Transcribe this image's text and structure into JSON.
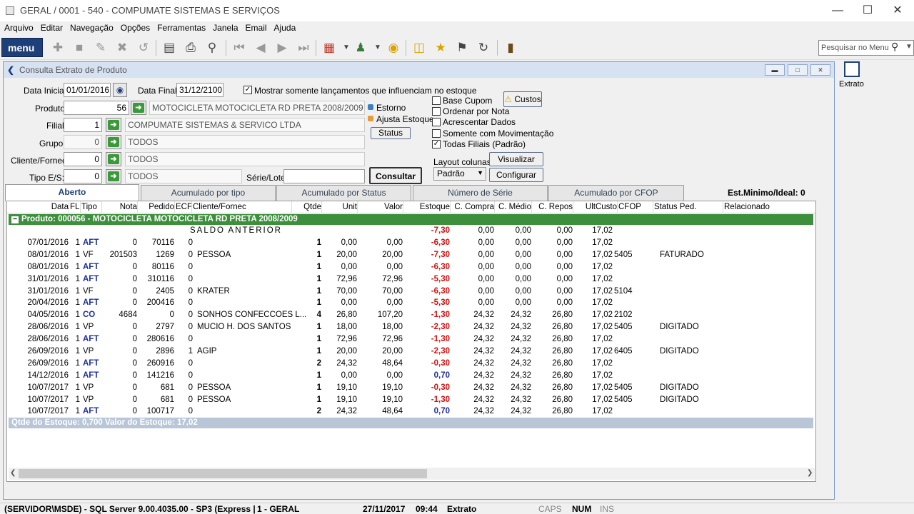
{
  "app": {
    "title": "GERAL / 0001 - 540 - COMPUMATE SISTEMAS E SERVIÇOS"
  },
  "menu": [
    "Arquivo",
    "Editar",
    "Navegação",
    "Opções",
    "Ferramentas",
    "Janela",
    "Email",
    "Ajuda"
  ],
  "toolbar": {
    "menu_label": "menu",
    "search_placeholder": "Pesquisar no Menu"
  },
  "side": {
    "extrato_label": "Extrato"
  },
  "window": {
    "title": "Consulta Extrato de Produto"
  },
  "form": {
    "data_inicial_label": "Data Inicial:",
    "data_inicial": "01/01/2016",
    "data_final_label": "Data Final:",
    "data_final": "31/12/2100",
    "mostrar_label": "Mostrar somente lançamentos que influenciam no estoque",
    "produto_label": "Produto:",
    "produto_code": "56",
    "produto_desc": "MOTOCICLETA  MOTOCICLETA RD PRETA 2008/2009",
    "filial_label": "Filial:",
    "filial_code": "1",
    "filial_desc": "COMPUMATE SISTEMAS & SERVICO LTDA",
    "grupo_label": "Grupo:",
    "grupo_code": "0",
    "grupo_desc": "TODOS",
    "cliente_label": "Cliente/Fornec:",
    "cliente_code": "0",
    "cliente_desc": "TODOS",
    "tipo_label": "Tipo E/S:",
    "tipo_code": "0",
    "tipo_desc": "TODOS",
    "serie_label": "Série/Lote:",
    "serie_value": "",
    "estorno_label": "Estorno",
    "ajusta_label": "Ajusta Estoque",
    "status_btn": "Status",
    "consultar_btn": "Consultar",
    "base_cupom": "Base Cupom",
    "ordenar_nota": "Ordenar por Nota",
    "acrescentar": "Acrescentar Dados",
    "somente_mov": "Somente com Movimentação",
    "todas_filiais": "Todas Filiais (Padrão)",
    "custos_btn": "Custos",
    "layout_label": "Layout colunas",
    "layout_value": "Padrão",
    "visualizar_btn": "Visualizar",
    "configurar_btn": "Configurar"
  },
  "tabs": [
    "Aberto",
    "Acumulado por tipo",
    "Acumulado por Status",
    "Número de Série",
    "Acumulado por CFOP"
  ],
  "est_minimo": "Est.Minimo/Ideal:  0",
  "grid": {
    "headers": [
      "Data",
      "FL",
      "Tipo",
      "Nota",
      "Pedido",
      "ECF",
      "Cliente/Fornec",
      "Qtde",
      "Unit",
      "Valor",
      "Estoque",
      "C. Compra",
      "C. Médio",
      "C. Repos",
      "UltCusto",
      "CFOP",
      "Status Ped.",
      "Relacionado"
    ],
    "group": "Produto:  000056 - MOTOCICLETA  MOTOCICLETA RD PRETA 2008/2009",
    "saldo": {
      "label": "SALDO ANTERIOR",
      "estoque": "-7,30",
      "c_compra": "0,00",
      "c_medio": "0,00",
      "c_repos": "0,00",
      "ult": "17,02"
    },
    "rows": [
      [
        "07/01/2016",
        "1",
        "AFT",
        "0",
        "70116",
        "0",
        "",
        "1",
        "0,00",
        "0,00",
        "-6,30",
        "0,00",
        "0,00",
        "0,00",
        "17,02",
        "",
        ""
      ],
      [
        "08/01/2016",
        "1",
        "VF",
        "201503",
        "1269",
        "0",
        "PESSOA",
        "1",
        "20,00",
        "20,00",
        "-7,30",
        "0,00",
        "0,00",
        "0,00",
        "17,02",
        "5405",
        "FATURADO"
      ],
      [
        "08/01/2016",
        "1",
        "AFT",
        "0",
        "80116",
        "0",
        "",
        "1",
        "0,00",
        "0,00",
        "-6,30",
        "0,00",
        "0,00",
        "0,00",
        "17,02",
        "",
        ""
      ],
      [
        "31/01/2016",
        "1",
        "AFT",
        "0",
        "310116",
        "0",
        "",
        "1",
        "72,96",
        "72,96",
        "-5,30",
        "0,00",
        "0,00",
        "0,00",
        "17,02",
        "",
        ""
      ],
      [
        "31/01/2016",
        "1",
        "VF",
        "0",
        "2405",
        "0",
        "KRATER",
        "1",
        "70,00",
        "70,00",
        "-6,30",
        "0,00",
        "0,00",
        "0,00",
        "17,02",
        "5104",
        ""
      ],
      [
        "20/04/2016",
        "1",
        "AFT",
        "0",
        "200416",
        "0",
        "",
        "1",
        "0,00",
        "0,00",
        "-5,30",
        "0,00",
        "0,00",
        "0,00",
        "17,02",
        "",
        ""
      ],
      [
        "04/05/2016",
        "1",
        "CO",
        "4684",
        "0",
        "0",
        "SONHOS CONFECCOES L...",
        "4",
        "26,80",
        "107,20",
        "-1,30",
        "24,32",
        "24,32",
        "26,80",
        "17,02",
        "2102",
        ""
      ],
      [
        "28/06/2016",
        "1",
        "VP",
        "0",
        "2797",
        "0",
        "MUCIO H. DOS SANTOS",
        "1",
        "18,00",
        "18,00",
        "-2,30",
        "24,32",
        "24,32",
        "26,80",
        "17,02",
        "5405",
        "DIGITADO"
      ],
      [
        "28/06/2016",
        "1",
        "AFT",
        "0",
        "280616",
        "0",
        "",
        "1",
        "72,96",
        "72,96",
        "-1,30",
        "24,32",
        "24,32",
        "26,80",
        "17,02",
        "",
        ""
      ],
      [
        "26/09/2016",
        "1",
        "VP",
        "0",
        "2896",
        "1",
        "AGIP",
        "1",
        "20,00",
        "20,00",
        "-2,30",
        "24,32",
        "24,32",
        "26,80",
        "17,02",
        "6405",
        "DIGITADO"
      ],
      [
        "26/09/2016",
        "1",
        "AFT",
        "0",
        "260916",
        "0",
        "",
        "2",
        "24,32",
        "48,64",
        "-0,30",
        "24,32",
        "24,32",
        "26,80",
        "17,02",
        "",
        ""
      ],
      [
        "14/12/2016",
        "1",
        "AFT",
        "0",
        "141216",
        "0",
        "",
        "1",
        "0,00",
        "0,00",
        "0,70",
        "24,32",
        "24,32",
        "26,80",
        "17,02",
        "",
        ""
      ],
      [
        "10/07/2017",
        "1",
        "VP",
        "0",
        "681",
        "0",
        "PESSOA",
        "1",
        "19,10",
        "19,10",
        "-0,30",
        "24,32",
        "24,32",
        "26,80",
        "17,02",
        "5405",
        "DIGITADO"
      ],
      [
        "10/07/2017",
        "1",
        "VP",
        "0",
        "681",
        "0",
        "PESSOA",
        "1",
        "19,10",
        "19,10",
        "-1,30",
        "24,32",
        "24,32",
        "26,80",
        "17,02",
        "5405",
        "DIGITADO"
      ],
      [
        "10/07/2017",
        "1",
        "AFT",
        "0",
        "100717",
        "0",
        "",
        "2",
        "24,32",
        "48,64",
        "0,70",
        "24,32",
        "24,32",
        "26,80",
        "17,02",
        "",
        ""
      ]
    ],
    "footer": "Qtde do Estoque: 0,700    Valor do Estoque: 17,02"
  },
  "status": {
    "server": "(SERVIDOR\\MSDE) - SQL Server 9.00.4035.00 - SP3 (Express |",
    "empresa": "1 - GERAL",
    "date": "27/11/2017",
    "time": "09:44",
    "screen": "Extrato",
    "caps": "CAPS",
    "num": "NUM",
    "ins": "INS"
  },
  "colors": {
    "neg": "#d01010",
    "pos": "#1e2f9a",
    "group": "#3d8f3d"
  }
}
